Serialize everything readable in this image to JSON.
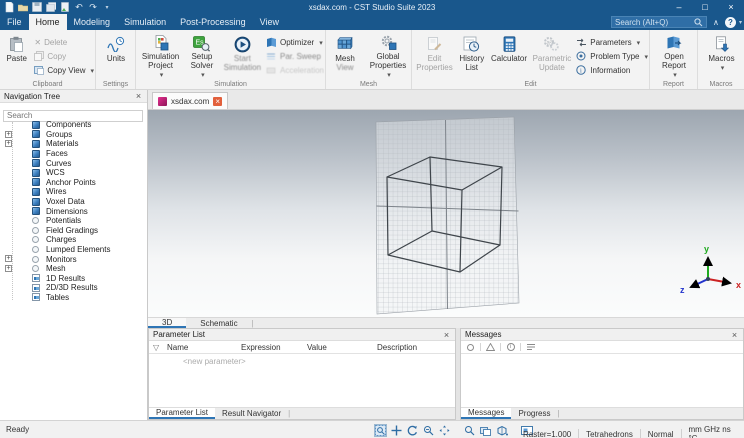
{
  "window": {
    "title": "xsdax.com - CST Studio Suite 2023"
  },
  "menu": {
    "tabs": [
      "File",
      "Home",
      "Modeling",
      "Simulation",
      "Post-Processing",
      "View"
    ],
    "search_placeholder": "Search (Alt+Q)"
  },
  "ribbon": {
    "clipboard": {
      "group": "Clipboard",
      "paste": "Paste",
      "delete": "Delete",
      "copy": "Copy",
      "copy_view": "Copy View"
    },
    "settings": {
      "group": "Settings",
      "units": "Units"
    },
    "simulation": {
      "group": "Simulation",
      "project": [
        "Simulation",
        "Project"
      ],
      "solver": [
        "Setup",
        "Solver"
      ],
      "start": [
        "Start",
        "Simulation"
      ],
      "optimizer": "Optimizer",
      "par_sweep": "Par. Sweep",
      "acceleration": "Acceleration"
    },
    "mesh": {
      "group": "Mesh",
      "mesh_view": [
        "Mesh",
        "View"
      ],
      "global_properties": [
        "Global",
        "Properties"
      ]
    },
    "edit": {
      "group": "Edit",
      "edit_properties": [
        "Edit",
        "Properties"
      ],
      "history_list": [
        "History",
        "List"
      ],
      "calculator": "Calculator",
      "parametric_update": [
        "Parametric",
        "Update"
      ],
      "parameters": "Parameters",
      "problem_type": "Problem Type",
      "information": "Information"
    },
    "report": {
      "group": "Report",
      "open_report": [
        "Open",
        "Report"
      ]
    },
    "macros": {
      "group": "Macros",
      "macros": "Macros"
    }
  },
  "nav_tree": {
    "title": "Navigation Tree",
    "search_placeholder": "Search",
    "items": [
      {
        "label": "Components"
      },
      {
        "label": "Groups"
      },
      {
        "label": "Materials"
      },
      {
        "label": "Faces"
      },
      {
        "label": "Curves"
      },
      {
        "label": "WCS"
      },
      {
        "label": "Anchor Points"
      },
      {
        "label": "Wires"
      },
      {
        "label": "Voxel Data"
      },
      {
        "label": "Dimensions"
      },
      {
        "label": "Potentials"
      },
      {
        "label": "Field Gradings"
      },
      {
        "label": "Charges"
      },
      {
        "label": "Lumped Elements"
      },
      {
        "label": "Monitors"
      },
      {
        "label": "Mesh"
      },
      {
        "label": "1D Results"
      },
      {
        "label": "2D/3D Results"
      },
      {
        "label": "Tables"
      }
    ]
  },
  "doc_tab": {
    "label": "xsdax.com"
  },
  "view_tabs": {
    "t3d": "3D",
    "schematic": "Schematic"
  },
  "parameter_list": {
    "title": "Parameter List",
    "columns": [
      "Name",
      "Expression",
      "Value",
      "Description"
    ],
    "placeholder_row": "<new parameter>",
    "tab_parameter_list": "Parameter List",
    "tab_result_navigator": "Result Navigator"
  },
  "messages": {
    "title": "Messages",
    "tab_messages": "Messages",
    "tab_progress": "Progress"
  },
  "status": {
    "ready": "Ready",
    "raster": "Raster=1.000",
    "mesh_type": "Tetrahedrons",
    "view_mode": "Normal",
    "units": "mm GHz ns °C"
  },
  "axes": {
    "x": "x",
    "y": "y",
    "z": "z"
  },
  "colors": {
    "titlebar": "#19578c",
    "accent": "#2e75b5",
    "axis_x": "#cc2222",
    "axis_y": "#1faa1f",
    "axis_z": "#2233cc"
  }
}
